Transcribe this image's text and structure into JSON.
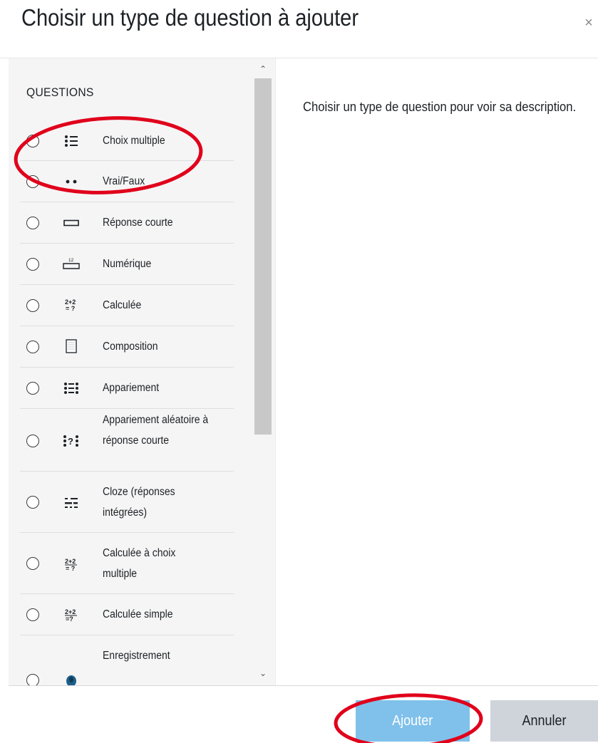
{
  "dialog": {
    "title": "Choisir un type de question à ajouter",
    "close_symbol": "×"
  },
  "list": {
    "section_label": "QUESTIONS",
    "items": [
      {
        "label": "Choix multiple",
        "icon": "multichoice-icon"
      },
      {
        "label": "Vrai/Faux",
        "icon": "truefalse-icon"
      },
      {
        "label": "Réponse courte",
        "icon": "shortanswer-icon"
      },
      {
        "label": "Numérique",
        "icon": "numerical-icon"
      },
      {
        "label": "Calculée",
        "icon": "calculated-icon"
      },
      {
        "label": "Composition",
        "icon": "essay-icon"
      },
      {
        "label": "Appariement",
        "icon": "match-icon"
      },
      {
        "label": "Appariement aléatoire à réponse courte",
        "icon": "randomsamatch-icon"
      },
      {
        "label": "Cloze (réponses intégrées)",
        "icon": "multianswer-icon"
      },
      {
        "label": "Calculée à choix multiple",
        "icon": "calculatedmulti-icon"
      },
      {
        "label": "Calculée simple",
        "icon": "calculatedsimple-icon"
      },
      {
        "label": "Enregistrement",
        "icon": "recording-icon"
      }
    ]
  },
  "description": {
    "text": "Choisir un type de question pour voir sa description."
  },
  "footer": {
    "add_label": "Ajouter",
    "cancel_label": "Annuler"
  },
  "colors": {
    "primary_button": "#7fc1ea",
    "secondary_button": "#ced4da",
    "annotation": "#e0001b",
    "list_background": "#f5f5f5"
  }
}
